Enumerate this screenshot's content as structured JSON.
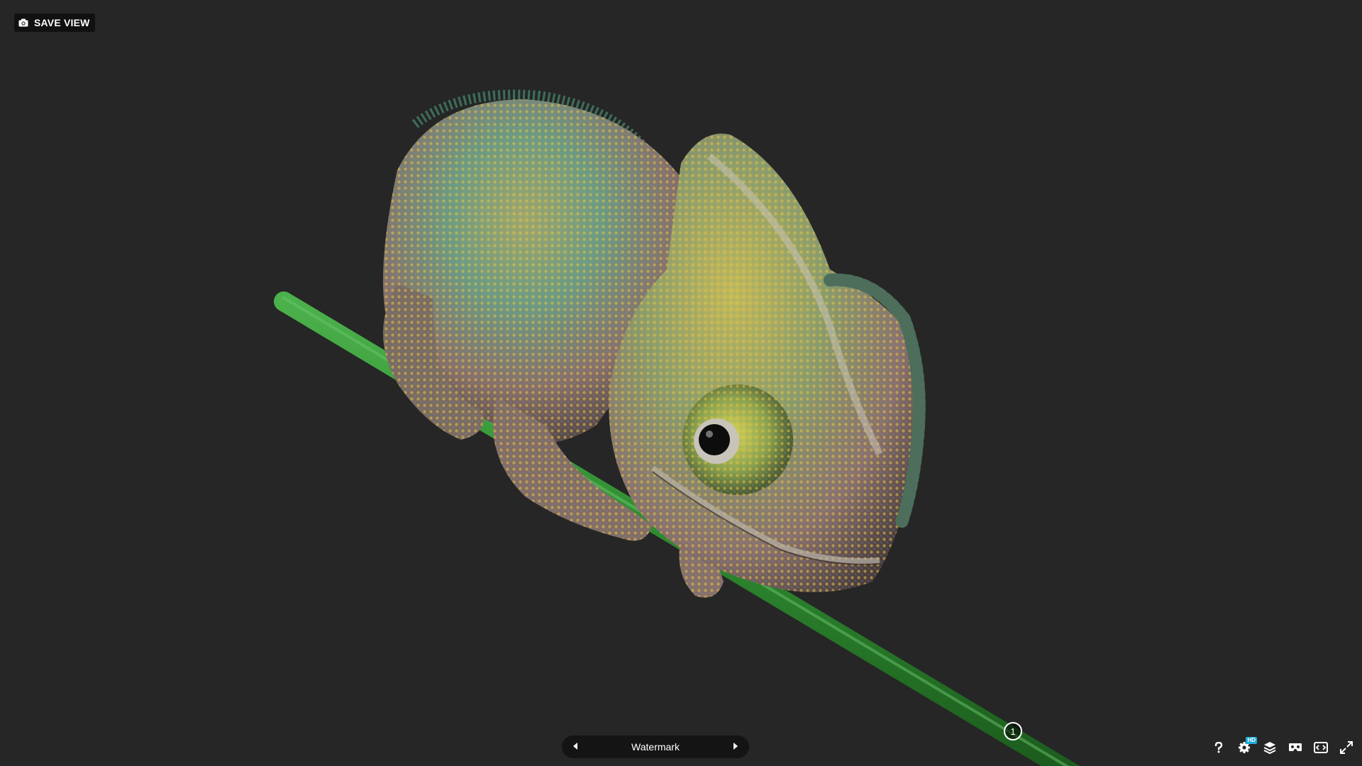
{
  "toolbar_top": {
    "save_view_label": "SAVE VIEW"
  },
  "annotation_nav": {
    "label": "Watermark"
  },
  "hotspot": {
    "number": "1"
  },
  "viewer_toolbar": {
    "hd_badge": "HD"
  },
  "icons": [
    "camera-icon",
    "chevron-left-icon",
    "chevron-right-icon",
    "help-icon",
    "settings-icon",
    "layers-icon",
    "vr-icon",
    "embed-icon",
    "fullscreen-icon"
  ],
  "colors": {
    "background": "#262626",
    "branch": "#2f8a2f",
    "hd_badge": "#1caad9"
  }
}
